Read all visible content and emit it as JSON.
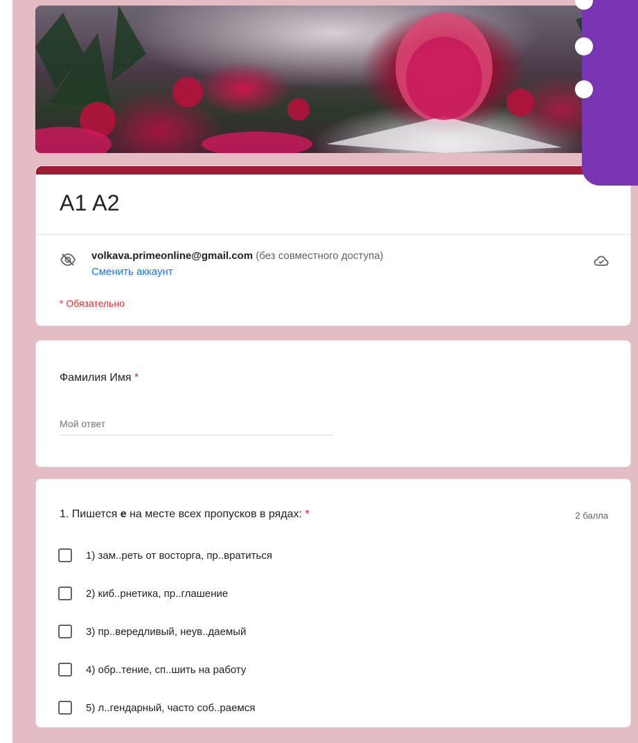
{
  "form": {
    "title": "A1 A2",
    "account": {
      "email": "volkava.primeonline@gmail.com",
      "sharing_status": "(без совместного доступа)",
      "switch_link": "Сменить аккаунт",
      "icons": [
        "eye-off-icon",
        "cloud-check-icon"
      ]
    },
    "required_note": "* Обязательно",
    "colors": {
      "accent": "#9d1b35",
      "background": "#e3bcc4",
      "required": "#d93025",
      "link": "#1a73e8",
      "overlay": "#7a35b5"
    }
  },
  "name_question": {
    "label": "Фамилия Имя",
    "required_mark": "*",
    "placeholder": "Мой ответ"
  },
  "question_1": {
    "label_prefix": "1. Пишется ",
    "label_bold": "е",
    "label_suffix": " на месте всех пропусков в рядах:",
    "required_mark": "*",
    "points": "2 балла",
    "options": [
      "1) зам..реть от восторга, пр..вратиться",
      "2) киб..рнетика, пр..глашение",
      "3) пр..вередливый, неув..даемый",
      "4) обр..тение, сп..шить на работу",
      "5) л..гендарный, часто соб..раемся"
    ]
  }
}
